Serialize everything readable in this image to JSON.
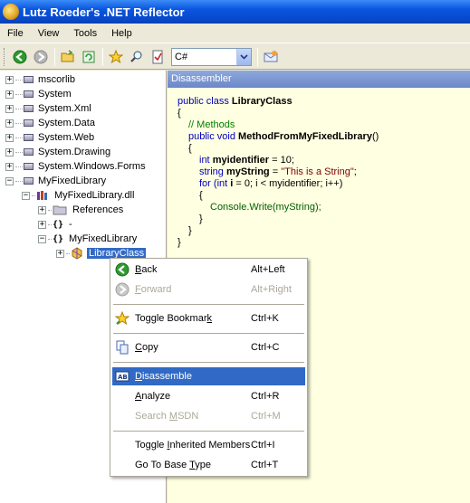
{
  "window": {
    "title": "Lutz Roeder's .NET Reflector"
  },
  "menu": [
    "File",
    "View",
    "Tools",
    "Help"
  ],
  "toolbar": {
    "language": "C#"
  },
  "tree": {
    "items": [
      {
        "label": "mscorlib"
      },
      {
        "label": "System"
      },
      {
        "label": "System.Xml"
      },
      {
        "label": "System.Data"
      },
      {
        "label": "System.Web"
      },
      {
        "label": "System.Drawing"
      },
      {
        "label": "System.Windows.Forms"
      },
      {
        "label": "MyFixedLibrary"
      },
      {
        "label": "MyFixedLibrary.dll"
      },
      {
        "label": "References"
      },
      {
        "label": "-"
      },
      {
        "label": "MyFixedLibrary"
      },
      {
        "label": "LibraryClass"
      }
    ]
  },
  "pane": {
    "header": "Disassembler",
    "code": {
      "l1a": "public class ",
      "l1b": "LibraryClass",
      "l2": "{",
      "l3": "// Methods",
      "l4a": "public void ",
      "l4b": "MethodFromMyFixedLibrary",
      "l4c": "()",
      "l5": "{",
      "l6a": "int ",
      "l6b": "myidentifier",
      "l6c": " = 10;",
      "l7a": "string ",
      "l7b": "myString",
      "l7c": " = ",
      "l7d": "\"This is a String\"",
      "l7e": ";",
      "l8a": "for ",
      "l8b": "(int ",
      "l8c": "i",
      "l8d": " = 0; ",
      "l8e": "i",
      "l8f": " < myidentifier; ",
      "l8g": "i",
      "l8h": "++)",
      "l9": "{",
      "l10a": "Console",
      "l10b": ".Write(myString);",
      "l11": "}",
      "l12": "}",
      "l13": "}"
    }
  },
  "context_menu": {
    "back": {
      "pre": "",
      "ul": "B",
      "post": "ack",
      "shortcut": "Alt+Left"
    },
    "forward": {
      "pre": "",
      "ul": "F",
      "post": "orward",
      "shortcut": "Alt+Right"
    },
    "bookmark": {
      "pre": "Toggle Bookmar",
      "ul": "k",
      "post": "",
      "shortcut": "Ctrl+K"
    },
    "copy": {
      "pre": "",
      "ul": "C",
      "post": "opy",
      "shortcut": "Ctrl+C"
    },
    "disassemble": {
      "pre": "",
      "ul": "D",
      "post": "isassemble",
      "shortcut": ""
    },
    "analyze": {
      "pre": "",
      "ul": "A",
      "post": "nalyze",
      "shortcut": "Ctrl+R"
    },
    "search": {
      "pre": "Search ",
      "ul": "M",
      "post": "SDN",
      "shortcut": "Ctrl+M"
    },
    "inherited": {
      "pre": "Toggle ",
      "ul": "I",
      "post": "nherited Members",
      "shortcut": "Ctrl+I"
    },
    "basetype": {
      "pre": "Go To Base ",
      "ul": "T",
      "post": "ype",
      "shortcut": "Ctrl+T"
    }
  }
}
